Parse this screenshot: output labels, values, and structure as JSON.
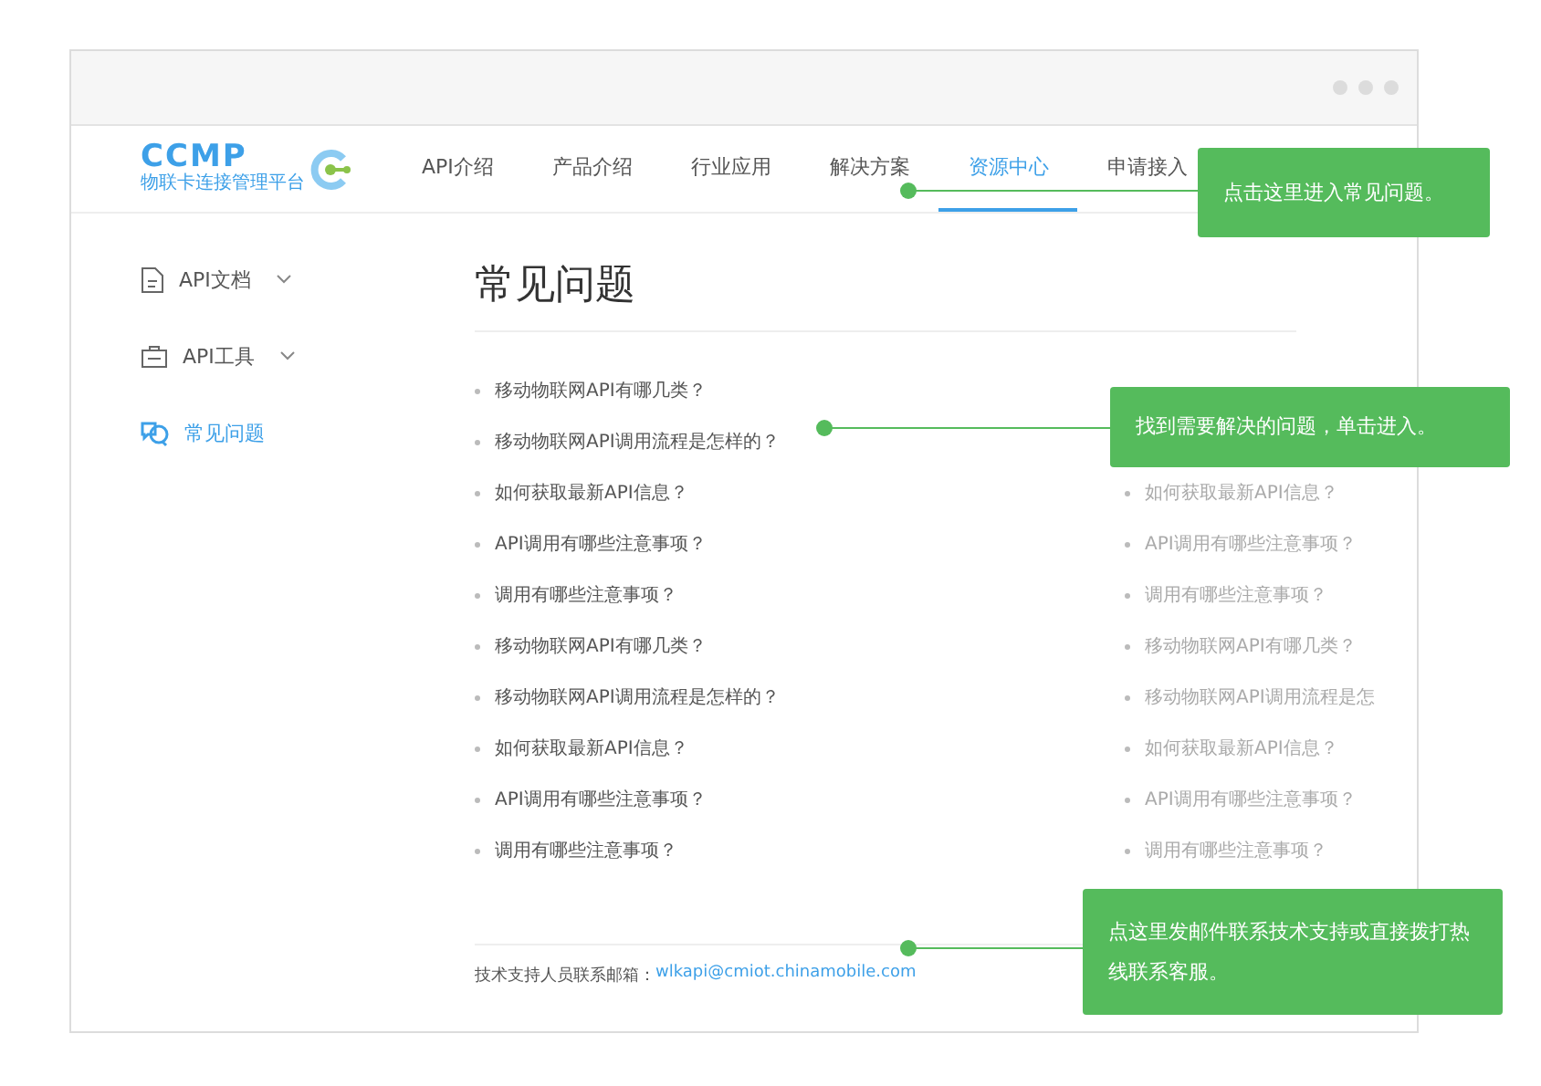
{
  "logo": {
    "wordmark": "CCMP",
    "tagline": "物联卡连接管理平台"
  },
  "nav": [
    {
      "label": "API介绍",
      "selected": false
    },
    {
      "label": "产品介绍",
      "selected": false
    },
    {
      "label": "行业应用",
      "selected": false
    },
    {
      "label": "解决方案",
      "selected": false
    },
    {
      "label": "资源中心",
      "selected": true
    },
    {
      "label": "申请接入",
      "selected": false
    }
  ],
  "sidebar": [
    {
      "label": "API文档",
      "kind": "document",
      "expandable": true,
      "selected": false
    },
    {
      "label": "API工具",
      "kind": "toolbox",
      "expandable": true,
      "selected": false
    },
    {
      "label": "常见问题",
      "kind": "qa",
      "expandable": false,
      "selected": true
    }
  ],
  "page_title": "常见问题",
  "faq_left": [
    "移动物联网API有哪几类？",
    "移动物联网API调用流程是怎样的？",
    "如何获取最新API信息？",
    "API调用有哪些注意事项？",
    "调用有哪些注意事项？",
    "移动物联网API有哪几类？",
    "移动物联网API调用流程是怎样的？",
    "如何获取最新API信息？",
    "API调用有哪些注意事项？",
    "调用有哪些注意事项？"
  ],
  "faq_right": [
    "如何获取最新API信息？",
    "API调用有哪些注意事项？",
    "调用有哪些注意事项？",
    "移动物联网API有哪几类？",
    "移动物联网API调用流程是怎",
    "如何获取最新API信息？",
    "API调用有哪些注意事项？",
    "调用有哪些注意事项？"
  ],
  "footer": {
    "label": "技术支持人员联系邮箱：",
    "email": "wlkapi@cmiot.chinamobile.com"
  },
  "callouts": [
    {
      "text": "点击这里进入常见问题。"
    },
    {
      "text": "找到需要解决的问题，单击进入。"
    },
    {
      "text": "点这里发邮件联系技术支持或直接拨打热线联系客服。"
    }
  ]
}
